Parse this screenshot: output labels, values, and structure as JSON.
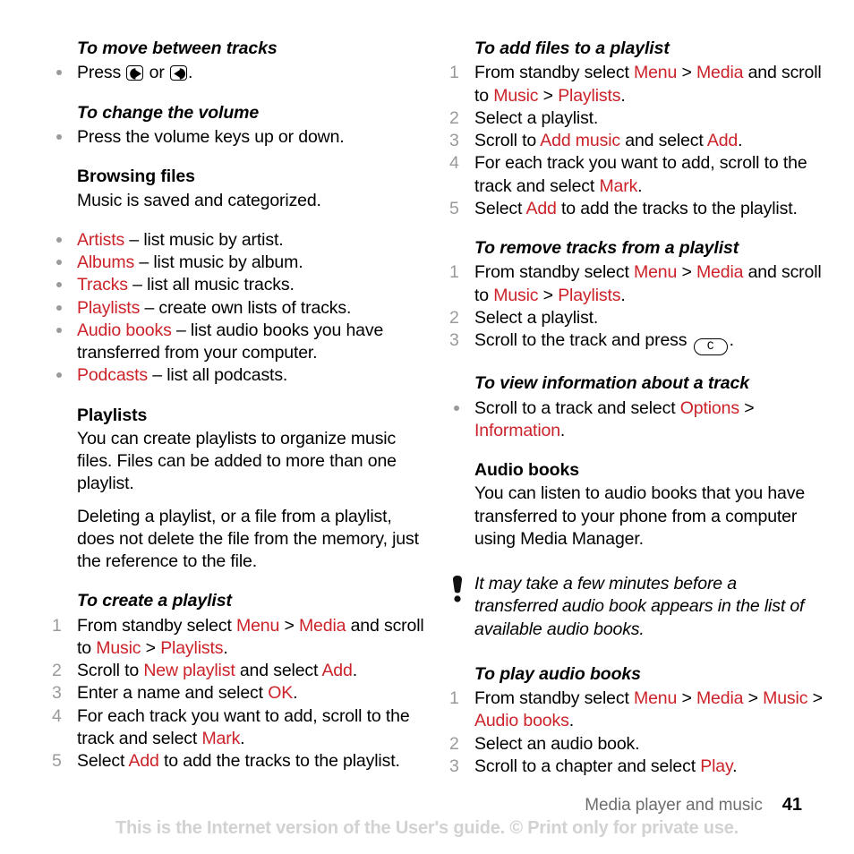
{
  "page": {
    "number": "41",
    "chapter": "Media player and music",
    "watermark": "This is the Internet version of the User's guide. © Print only for private use."
  },
  "icons": {
    "nav_right": "nav-right-key-icon",
    "nav_left": "nav-left-key-icon",
    "clear_key_label": "C",
    "note": "exclamation-note-icon"
  },
  "left_column": {
    "s1": {
      "heading": "To move between tracks",
      "item_pre": "Press ",
      "item_mid": " or ",
      "item_post": "."
    },
    "s2": {
      "heading": "To change the volume",
      "item": "Press the volume keys up or down."
    },
    "s3": {
      "heading": "Browsing files",
      "para": "Music is saved and categorized.",
      "bullets": [
        {
          "term": "Artists",
          "rest": " – list music by artist."
        },
        {
          "term": "Albums",
          "rest": " – list music by album."
        },
        {
          "term": "Tracks",
          "rest": " – list all music tracks."
        },
        {
          "term": "Playlists",
          "rest": " – create own lists of tracks."
        },
        {
          "term": "Audio books",
          "rest": " – list audio books you have transferred from your computer."
        },
        {
          "term": "Podcasts",
          "rest": " – list all podcasts."
        }
      ]
    },
    "s4": {
      "heading": "Playlists",
      "para1": "You can create playlists to organize music files. Files can be added to more than one playlist.",
      "para2": "Deleting a playlist, or a file from a playlist, does not delete the file from the memory, just the reference to the file."
    },
    "s5": {
      "heading": "To create a playlist",
      "steps": [
        {
          "num": "1",
          "parts": [
            {
              "t": "From standby select ",
              "c": "black"
            },
            {
              "t": "Menu",
              "c": "red"
            },
            {
              "t": " > ",
              "c": "black"
            },
            {
              "t": "Media",
              "c": "red"
            },
            {
              "t": " and scroll to ",
              "c": "black"
            },
            {
              "t": "Music",
              "c": "red"
            },
            {
              "t": " > ",
              "c": "black"
            },
            {
              "t": "Playlists",
              "c": "red"
            },
            {
              "t": ".",
              "c": "black"
            }
          ]
        },
        {
          "num": "2",
          "parts": [
            {
              "t": "Scroll to ",
              "c": "black"
            },
            {
              "t": "New playlist",
              "c": "red"
            },
            {
              "t": " and select ",
              "c": "black"
            },
            {
              "t": "Add",
              "c": "red"
            },
            {
              "t": ".",
              "c": "black"
            }
          ]
        },
        {
          "num": "3",
          "parts": [
            {
              "t": "Enter a name and select ",
              "c": "black"
            },
            {
              "t": "OK",
              "c": "red"
            },
            {
              "t": ".",
              "c": "black"
            }
          ]
        },
        {
          "num": "4",
          "parts": [
            {
              "t": "For each track you want to add, scroll to the track and select ",
              "c": "black"
            },
            {
              "t": "Mark",
              "c": "red"
            },
            {
              "t": ".",
              "c": "black"
            }
          ]
        },
        {
          "num": "5",
          "parts": [
            {
              "t": "Select ",
              "c": "black"
            },
            {
              "t": "Add",
              "c": "red"
            },
            {
              "t": " to add the tracks to the playlist.",
              "c": "black"
            }
          ]
        }
      ]
    }
  },
  "right_column": {
    "s1": {
      "heading": "To add files to a playlist",
      "steps": [
        {
          "num": "1",
          "parts": [
            {
              "t": "From standby select ",
              "c": "black"
            },
            {
              "t": "Menu",
              "c": "red"
            },
            {
              "t": " > ",
              "c": "black"
            },
            {
              "t": "Media",
              "c": "red"
            },
            {
              "t": " and scroll to ",
              "c": "black"
            },
            {
              "t": "Music",
              "c": "red"
            },
            {
              "t": " > ",
              "c": "black"
            },
            {
              "t": "Playlists",
              "c": "red"
            },
            {
              "t": ".",
              "c": "black"
            }
          ]
        },
        {
          "num": "2",
          "parts": [
            {
              "t": "Select a playlist.",
              "c": "black"
            }
          ]
        },
        {
          "num": "3",
          "parts": [
            {
              "t": "Scroll to ",
              "c": "black"
            },
            {
              "t": "Add music",
              "c": "red"
            },
            {
              "t": " and select ",
              "c": "black"
            },
            {
              "t": "Add",
              "c": "red"
            },
            {
              "t": ".",
              "c": "black"
            }
          ]
        },
        {
          "num": "4",
          "parts": [
            {
              "t": "For each track you want to add, scroll to the track and select ",
              "c": "black"
            },
            {
              "t": "Mark",
              "c": "red"
            },
            {
              "t": ".",
              "c": "black"
            }
          ]
        },
        {
          "num": "5",
          "parts": [
            {
              "t": "Select ",
              "c": "black"
            },
            {
              "t": "Add",
              "c": "red"
            },
            {
              "t": " to add the tracks to the playlist.",
              "c": "black"
            }
          ]
        }
      ]
    },
    "s2": {
      "heading": "To remove tracks from a playlist",
      "steps": [
        {
          "num": "1",
          "parts": [
            {
              "t": "From standby select ",
              "c": "black"
            },
            {
              "t": "Menu",
              "c": "red"
            },
            {
              "t": " > ",
              "c": "black"
            },
            {
              "t": "Media",
              "c": "red"
            },
            {
              "t": " and scroll to ",
              "c": "black"
            },
            {
              "t": "Music",
              "c": "red"
            },
            {
              "t": " > ",
              "c": "black"
            },
            {
              "t": "Playlists",
              "c": "red"
            },
            {
              "t": ".",
              "c": "black"
            }
          ]
        },
        {
          "num": "2",
          "parts": [
            {
              "t": "Select a playlist.",
              "c": "black"
            }
          ]
        }
      ],
      "step3_num": "3",
      "step3_pre": "Scroll to the track and press ",
      "step3_post": "."
    },
    "s3": {
      "heading": "To view information about a track",
      "bullet_parts": [
        {
          "t": "Scroll to a track and select ",
          "c": "black"
        },
        {
          "t": "Options",
          "c": "red"
        },
        {
          "t": " > ",
          "c": "black"
        },
        {
          "t": "Information",
          "c": "red"
        },
        {
          "t": ".",
          "c": "black"
        }
      ]
    },
    "s4": {
      "heading": "Audio books",
      "para": "You can listen to audio books that you have transferred to your phone from a computer using Media Manager."
    },
    "note": "It may take a few minutes before a transferred audio book appears in the list of available audio books.",
    "s5": {
      "heading": "To play audio books",
      "steps": [
        {
          "num": "1",
          "parts": [
            {
              "t": "From standby select ",
              "c": "black"
            },
            {
              "t": "Menu",
              "c": "red"
            },
            {
              "t": " > ",
              "c": "black"
            },
            {
              "t": "Media",
              "c": "red"
            },
            {
              "t": " > ",
              "c": "black"
            },
            {
              "t": "Music",
              "c": "red"
            },
            {
              "t": " > ",
              "c": "black"
            },
            {
              "t": "Audio books",
              "c": "red"
            },
            {
              "t": ".",
              "c": "black"
            }
          ]
        },
        {
          "num": "2",
          "parts": [
            {
              "t": "Select an audio book.",
              "c": "black"
            }
          ]
        },
        {
          "num": "3",
          "parts": [
            {
              "t": "Scroll to a chapter and select ",
              "c": "black"
            },
            {
              "t": "Play",
              "c": "red"
            },
            {
              "t": ".",
              "c": "black"
            }
          ]
        }
      ]
    }
  }
}
